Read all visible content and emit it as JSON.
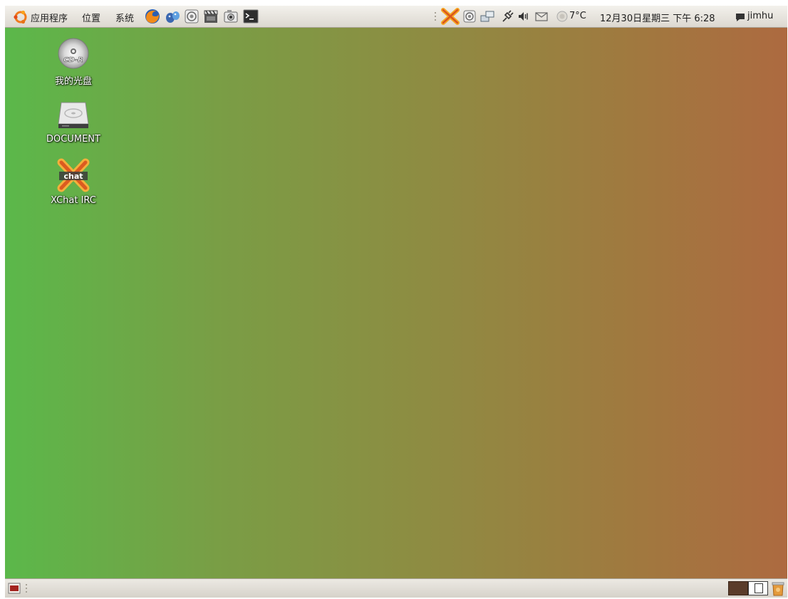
{
  "top_panel": {
    "menus": {
      "applications": "应用程序",
      "places": "位置",
      "system": "系统"
    },
    "launchers": [
      "firefox-icon",
      "pidgin-icon",
      "sound-icon",
      "movie-player-icon",
      "camera-icon",
      "terminal-icon"
    ],
    "tray": {
      "weather": "7°C",
      "clock": "12月30日星期三 下午 6:28",
      "user": "jimhu"
    }
  },
  "desktop": {
    "icons": [
      {
        "label": "我的光盘",
        "icon": "cdr-disc-icon"
      },
      {
        "label": "DOCUMENT",
        "icon": "hard-drive-icon"
      },
      {
        "label": "XChat IRC",
        "icon": "xchat-icon"
      }
    ],
    "cd_text": "CD-R",
    "xchat_text": "chat"
  },
  "colors": {
    "panel": "#e2dfd8",
    "desktop_left": "#5bb84a",
    "desktop_right": "#ad6a40",
    "ubuntu_orange": "#f07a1c"
  }
}
